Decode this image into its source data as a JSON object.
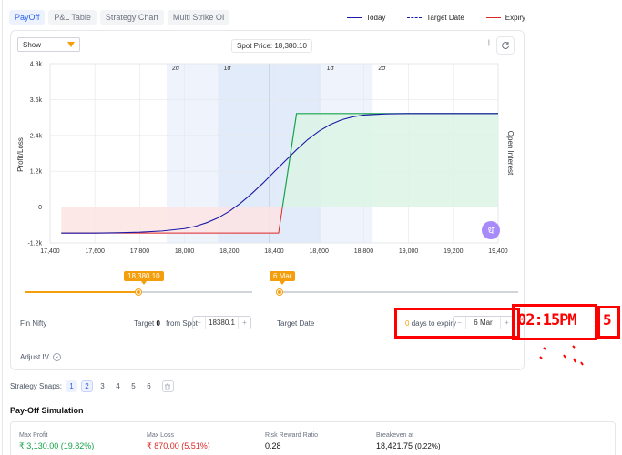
{
  "tabs": [
    {
      "label": "PayOff",
      "active": true
    },
    {
      "label": "P&L Table",
      "active": false
    },
    {
      "label": "Strategy Chart",
      "active": false
    },
    {
      "label": "Multi Strike OI",
      "active": false
    }
  ],
  "legend": [
    {
      "label": "Today",
      "color": "#1a1aa6",
      "style": "solid"
    },
    {
      "label": "Target Date",
      "color": "#1a1aa6",
      "style": "dashed"
    },
    {
      "label": "Expiry",
      "color": "#16a34a",
      "style": "solid"
    }
  ],
  "show_select": {
    "value": "Show"
  },
  "spot_price": "Spot Price: 18,380.10",
  "refresh_icon": "refresh-icon",
  "chart_data": {
    "type": "line",
    "ylabel": "Profit/Loss",
    "right_label": "Open Interest",
    "xlim": [
      17400,
      19400
    ],
    "ylim": [
      -1200,
      4800
    ],
    "x_ticks": [
      17400,
      17600,
      17800,
      18000,
      18200,
      18400,
      18600,
      18800,
      19000,
      19200,
      19400
    ],
    "x_tick_labels": [
      "17,400",
      "17,600",
      "17,800",
      "18,000",
      "18,200",
      "18,400",
      "18,600",
      "18,800",
      "19,000",
      "19,200",
      "19,400"
    ],
    "y_ticks": [
      -1200,
      0,
      1200,
      2400,
      3600,
      4800
    ],
    "y_tick_labels": [
      "-1.2k",
      "0",
      "1.2k",
      "2.4k",
      "3.6k",
      "4.8k"
    ],
    "sigma_bands": [
      {
        "label": "2σ",
        "from": 17920,
        "to": 18840
      },
      {
        "label": "1σ",
        "from": 18150,
        "to": 18610
      }
    ],
    "sigma_labels": [
      {
        "label": "2σ",
        "x": 17920
      },
      {
        "label": "1σ",
        "x": 18150
      },
      {
        "label": "1σ",
        "x": 18610
      },
      {
        "label": "2σ",
        "x": 18840
      }
    ],
    "spot_x": 18380.1,
    "series": [
      {
        "name": "Today",
        "color": "#1a1aa6",
        "x": [
          17450,
          17600,
          17700,
          17800,
          17900,
          18000,
          18050,
          18100,
          18150,
          18200,
          18250,
          18300,
          18350,
          18400,
          18450,
          18500,
          18550,
          18600,
          18650,
          18700,
          18750,
          18800,
          18900,
          19000,
          19100,
          19200,
          19400
        ],
        "y": [
          -870,
          -870,
          -860,
          -840,
          -800,
          -720,
          -640,
          -520,
          -360,
          -140,
          130,
          450,
          800,
          1180,
          1550,
          1920,
          2260,
          2540,
          2760,
          2920,
          3020,
          3080,
          3120,
          3130,
          3130,
          3130,
          3130
        ]
      },
      {
        "name": "Expiry",
        "color": "#16a34a",
        "x": [
          17450,
          18420,
          18500,
          19400
        ],
        "y": [
          -870,
          -870,
          3130,
          3130
        ]
      }
    ]
  },
  "spot_slider": {
    "label": "18,380.10",
    "fraction": 0.5
  },
  "date_slider": {
    "label": "6 Mar",
    "fraction": 0.0
  },
  "fin_nifty": "Fin Nifty",
  "target_label": "Target",
  "target_value": "0",
  "from_spot": "from Spot",
  "spot_input": "18380.1",
  "target_date_label": "Target Date",
  "days_expiry_count": "0",
  "days_expiry_text": "days to expiry",
  "date_input": "6 Mar",
  "handwritten_time": "02:15PM",
  "handwritten_extra": "5",
  "adjust_iv": "Adjust IV",
  "snaps_label": "Strategy Snaps:",
  "snaps": [
    "1",
    "2",
    "3",
    "4",
    "5",
    "6"
  ],
  "sim_title": "Pay-Off Simulation",
  "sim": [
    {
      "label": "Max Profit",
      "value": "₹ 3,130.00",
      "pct": "(19.82%)",
      "color": "#16a34a"
    },
    {
      "label": "Max Loss",
      "value": "₹ 870.00",
      "pct": "(5.51%)",
      "color": "#dc2626"
    },
    {
      "label": "Risk Reward Ratio",
      "value": "0.28",
      "pct": "",
      "color": "#111111"
    },
    {
      "label": "Breakeven at",
      "value": "18,421.75",
      "pct": "(0.22%)",
      "color": "#111111"
    }
  ]
}
